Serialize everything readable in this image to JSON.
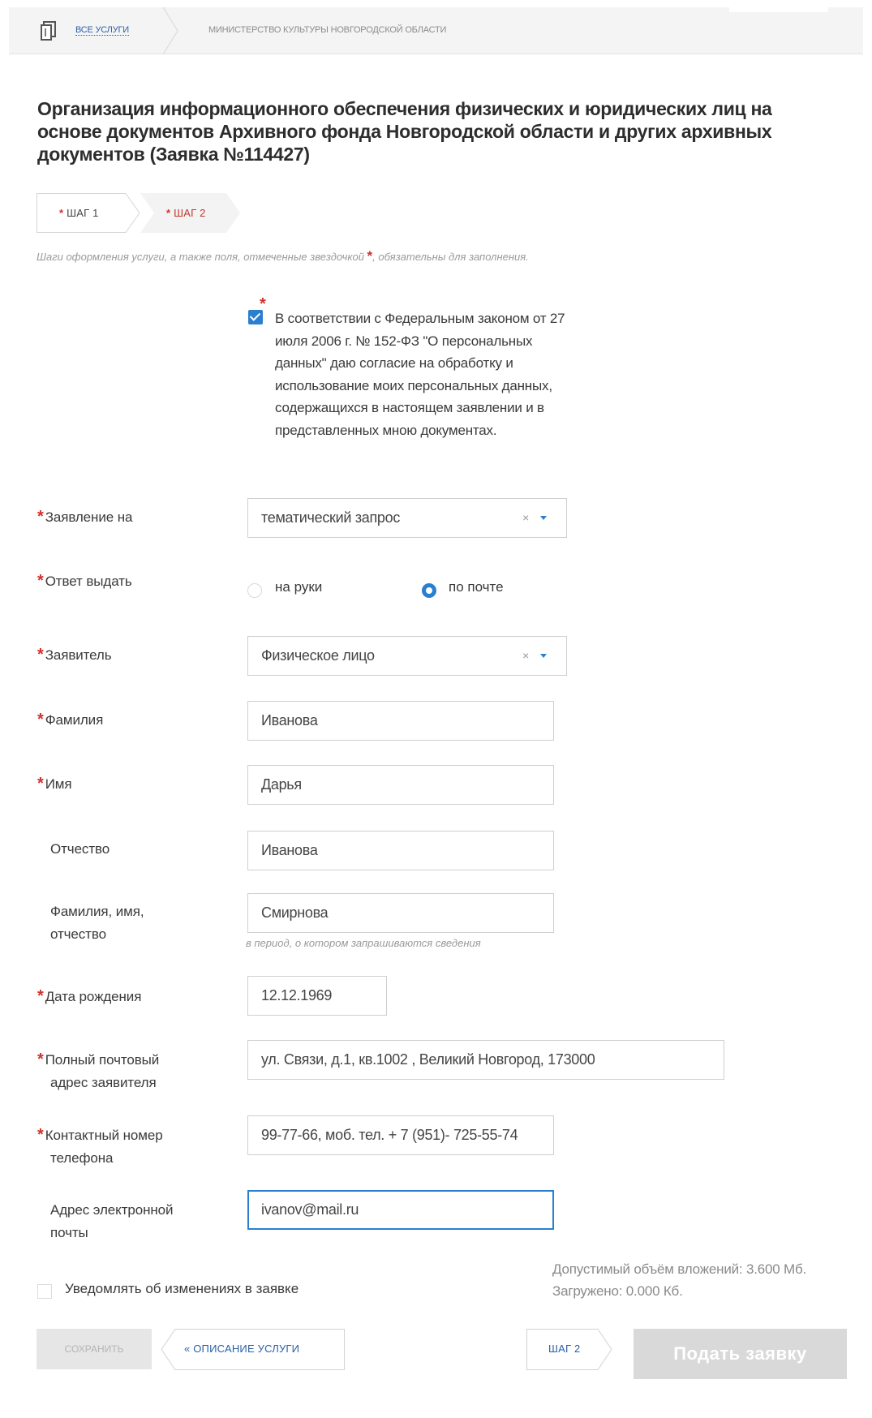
{
  "breadcrumb": {
    "all_services": "все услуги",
    "ministry": "министерство культуры новгородской области"
  },
  "page_title": "Организация информационного обеспечения физических и юридических лиц на основе документов Архивного фонда Новгородской области и других архивных документов (Заявка №114427)",
  "steps": [
    {
      "label": "шаг 1"
    },
    {
      "label": "шаг 2"
    }
  ],
  "required_hint": {
    "before": "Шаги оформления услуги, а также поля, отмеченные звездочкой",
    "after": ", обязательны для заполнения."
  },
  "consent": {
    "checked": true,
    "text": "В соответствии с Федеральным законом от 27 июля 2006 г. № 152-ФЗ \"О персональных данных\" даю согласие на обработку и использование моих персональных данных, содержащихся в настоящем заявлении и в представленных мною документах."
  },
  "form": {
    "statement": {
      "label": "Заявление на",
      "value": "тематический запрос",
      "clear": "×"
    },
    "response": {
      "label": "Ответ выдать",
      "options": [
        {
          "label": "на руки",
          "selected": false
        },
        {
          "label": "по почте",
          "selected": true
        }
      ]
    },
    "applicant": {
      "label": "Заявитель",
      "value": "Физическое лицо",
      "clear": "×"
    },
    "surname": {
      "label": "Фамилия",
      "value": "Иванова"
    },
    "name": {
      "label": "Имя",
      "value": "Дарья"
    },
    "patronymic": {
      "label": "Отчество",
      "value": "Иванова"
    },
    "full_name_period": {
      "label_line1": "Фамилия, имя,",
      "label_line2": "отчество",
      "value": "Смирнова",
      "hint": "в период, о котором запрашиваются сведения"
    },
    "birth_date": {
      "label": "Дата рождения",
      "value": "12.12.1969"
    },
    "address": {
      "label_line1": "Полный почтовый",
      "label_line2": "адрес заявителя",
      "value": "ул. Связи, д.1, кв.1002 , Великий Новгород, 173000"
    },
    "phone": {
      "label_line1": "Контактный номер",
      "label_line2": "телефона",
      "value": "99-77-66, моб. тел. + 7 (951)- 725-55-74"
    },
    "email": {
      "label_line1": "Адрес электронной",
      "label_line2": "почты",
      "value": "ivanov@mail.ru"
    }
  },
  "notify": {
    "label": "Уведомлять об изменениях в заявке",
    "checked": false
  },
  "attachments": {
    "limit": "Допустимый объём вложений: 3.600 Мб.",
    "uploaded": "Загружено: 0.000 Кб."
  },
  "buttons": {
    "save": "сохранить",
    "service_description": "« описание услуги",
    "step2": "шаг 2",
    "submit": "Подать заявку"
  },
  "colors": {
    "accent": "#2b7fd0",
    "link": "#2a61a8",
    "required": "#d0312d"
  }
}
